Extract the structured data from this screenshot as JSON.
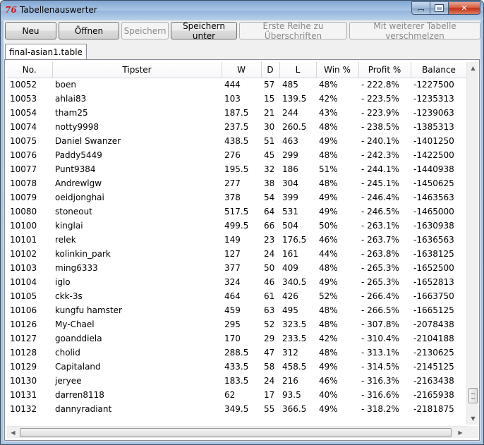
{
  "window": {
    "title": "Tabellenauswerter",
    "app_icon": "76"
  },
  "toolbar": {
    "buttons": [
      {
        "label": "Neu",
        "enabled": true
      },
      {
        "label": "Öffnen",
        "enabled": true
      },
      {
        "label": "Speichern",
        "enabled": false
      },
      {
        "label": "Speichern unter",
        "enabled": true
      },
      {
        "label": "Erste Reihe zu Überschriften",
        "enabled": false
      },
      {
        "label": "Mit weiterer Tabelle verschmelzen",
        "enabled": false
      }
    ]
  },
  "tab": {
    "label": "final-asian1.table"
  },
  "table": {
    "columns": [
      "No.",
      "Tipster",
      "W",
      "D",
      "L",
      "Win %",
      "Profit %",
      "Balance"
    ],
    "rows": [
      [
        "10052",
        "boen",
        "444",
        "57",
        "485",
        "48%",
        "- 222.8%",
        "-1227500"
      ],
      [
        "10053",
        "ahlai83",
        "103",
        "15",
        "139.5",
        "42%",
        "- 223.5%",
        "-1235313"
      ],
      [
        "10054",
        "tham25",
        "187.5",
        "21",
        "244",
        "43%",
        "- 223.9%",
        "-1239063"
      ],
      [
        "10074",
        "notty9998",
        "237.5",
        "30",
        "260.5",
        "48%",
        "- 238.5%",
        "-1385313"
      ],
      [
        "10075",
        "Daniel Swanzer",
        "438.5",
        "51",
        "463",
        "49%",
        "- 240.1%",
        "-1401250"
      ],
      [
        "10076",
        "Paddy5449",
        "276",
        "45",
        "299",
        "48%",
        "- 242.3%",
        "-1422500"
      ],
      [
        "10077",
        "Punt9384",
        "195.5",
        "32",
        "186",
        "51%",
        "- 244.1%",
        "-1440938"
      ],
      [
        "10078",
        "Andrewlgw",
        "277",
        "38",
        "304",
        "48%",
        "- 245.1%",
        "-1450625"
      ],
      [
        "10079",
        "oeidjonghai",
        "378",
        "54",
        "399",
        "49%",
        "- 246.4%",
        "-1463563"
      ],
      [
        "10080",
        "stoneout",
        "517.5",
        "64",
        "531",
        "49%",
        "- 246.5%",
        "-1465000"
      ],
      [
        "10100",
        "kinglai",
        "499.5",
        "66",
        "504",
        "50%",
        "- 263.1%",
        "-1630938"
      ],
      [
        "10101",
        "relek",
        "149",
        "23",
        "176.5",
        "46%",
        "- 263.7%",
        "-1636563"
      ],
      [
        "10102",
        "kolinkin_park",
        "127",
        "24",
        "161",
        "44%",
        "- 263.8%",
        "-1638125"
      ],
      [
        "10103",
        "ming6333",
        "377",
        "50",
        "409",
        "48%",
        "- 265.3%",
        "-1652500"
      ],
      [
        "10104",
        "iglo",
        "324",
        "46",
        "340.5",
        "49%",
        "- 265.3%",
        "-1652813"
      ],
      [
        "10105",
        "ckk-3s",
        "464",
        "61",
        "426",
        "52%",
        "- 266.4%",
        "-1663750"
      ],
      [
        "10106",
        "kungfu hamster",
        "459",
        "63",
        "495",
        "48%",
        "- 266.5%",
        "-1665125"
      ],
      [
        "10126",
        "My-Chael",
        "295",
        "52",
        "323.5",
        "48%",
        "- 307.8%",
        "-2078438"
      ],
      [
        "10127",
        "goanddiela",
        "170",
        "29",
        "233.5",
        "42%",
        "- 310.4%",
        "-2104188"
      ],
      [
        "10128",
        "cholid",
        "288.5",
        "47",
        "312",
        "48%",
        "- 313.1%",
        "-2130625"
      ],
      [
        "10129",
        "Capitaland",
        "433.5",
        "58",
        "458.5",
        "49%",
        "- 314.5%",
        "-2145125"
      ],
      [
        "10130",
        "jeryee",
        "183.5",
        "24",
        "216",
        "46%",
        "- 316.3%",
        "-2163438"
      ],
      [
        "10131",
        "darren8118",
        "62",
        "17",
        "93.5",
        "40%",
        "- 316.6%",
        "-2165938"
      ],
      [
        "10132",
        "dannyradiant",
        "349.5",
        "55",
        "366.5",
        "49%",
        "- 318.2%",
        "-2181875"
      ]
    ]
  }
}
